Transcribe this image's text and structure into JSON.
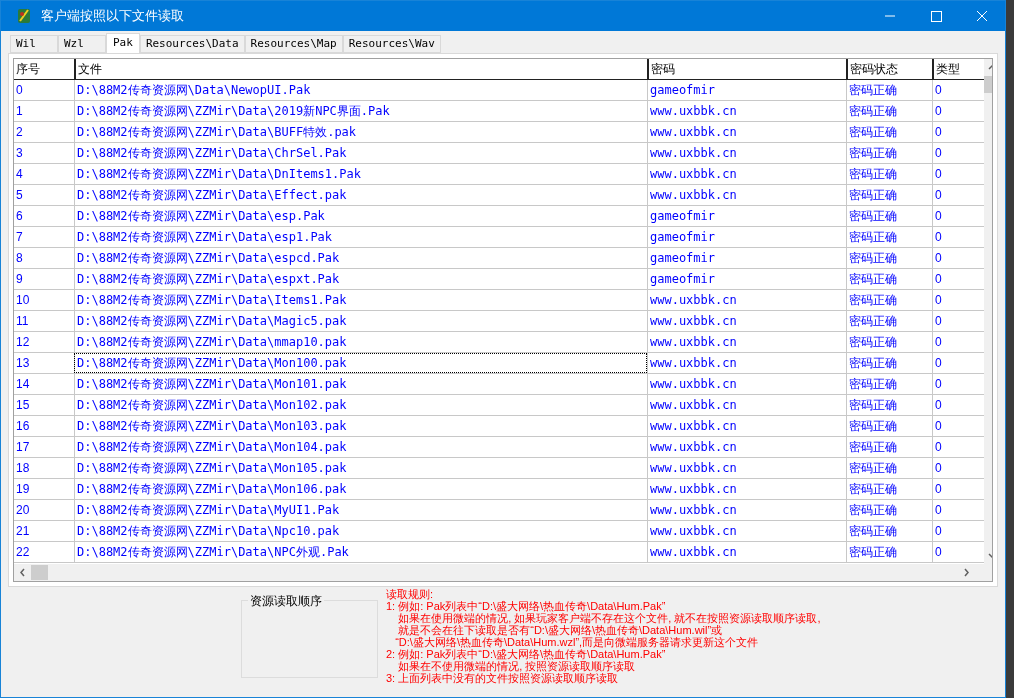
{
  "window": {
    "title": "客户端按照以下文件读取"
  },
  "tabs": [
    {
      "label": "Wil",
      "selected": false
    },
    {
      "label": "Wzl",
      "selected": false
    },
    {
      "label": "Pak",
      "selected": true
    },
    {
      "label": "Resources\\Data",
      "selected": false
    },
    {
      "label": "Resources\\Map",
      "selected": false
    },
    {
      "label": "Resources\\Wav",
      "selected": false
    }
  ],
  "table": {
    "columns": [
      "序号",
      "文件",
      "密码",
      "密码状态",
      "类型"
    ],
    "rows": [
      {
        "cells": [
          "0",
          "D:\\88M2传奇资源网\\Data\\NewopUI.Pak",
          "gameofmir",
          "密码正确",
          "0"
        ],
        "focused": false
      },
      {
        "cells": [
          "1",
          "D:\\88M2传奇资源网\\ZZMir\\Data\\2019新NPC界面.Pak",
          "www.uxbbk.cn",
          "密码正确",
          "0"
        ],
        "focused": false
      },
      {
        "cells": [
          "2",
          "D:\\88M2传奇资源网\\ZZMir\\Data\\BUFF特效.pak",
          "www.uxbbk.cn",
          "密码正确",
          "0"
        ],
        "focused": false
      },
      {
        "cells": [
          "3",
          "D:\\88M2传奇资源网\\ZZMir\\Data\\ChrSel.Pak",
          "www.uxbbk.cn",
          "密码正确",
          "0"
        ],
        "focused": false
      },
      {
        "cells": [
          "4",
          "D:\\88M2传奇资源网\\ZZMir\\Data\\DnItems1.Pak",
          "www.uxbbk.cn",
          "密码正确",
          "0"
        ],
        "focused": false
      },
      {
        "cells": [
          "5",
          "D:\\88M2传奇资源网\\ZZMir\\Data\\Effect.pak",
          "www.uxbbk.cn",
          "密码正确",
          "0"
        ],
        "focused": false
      },
      {
        "cells": [
          "6",
          "D:\\88M2传奇资源网\\ZZMir\\Data\\esp.Pak",
          "gameofmir",
          "密码正确",
          "0"
        ],
        "focused": false
      },
      {
        "cells": [
          "7",
          "D:\\88M2传奇资源网\\ZZMir\\Data\\esp1.Pak",
          "gameofmir",
          "密码正确",
          "0"
        ],
        "focused": false
      },
      {
        "cells": [
          "8",
          "D:\\88M2传奇资源网\\ZZMir\\Data\\espcd.Pak",
          "gameofmir",
          "密码正确",
          "0"
        ],
        "focused": false
      },
      {
        "cells": [
          "9",
          "D:\\88M2传奇资源网\\ZZMir\\Data\\espxt.Pak",
          "gameofmir",
          "密码正确",
          "0"
        ],
        "focused": false
      },
      {
        "cells": [
          "10",
          "D:\\88M2传奇资源网\\ZZMir\\Data\\Items1.Pak",
          "www.uxbbk.cn",
          "密码正确",
          "0"
        ],
        "focused": false
      },
      {
        "cells": [
          "11",
          "D:\\88M2传奇资源网\\ZZMir\\Data\\Magic5.pak",
          "www.uxbbk.cn",
          "密码正确",
          "0"
        ],
        "focused": false
      },
      {
        "cells": [
          "12",
          "D:\\88M2传奇资源网\\ZZMir\\Data\\mmap10.pak",
          "www.uxbbk.cn",
          "密码正确",
          "0"
        ],
        "focused": false
      },
      {
        "cells": [
          "13",
          "D:\\88M2传奇资源网\\ZZMir\\Data\\Mon100.pak",
          "www.uxbbk.cn",
          "密码正确",
          "0"
        ],
        "focused": true
      },
      {
        "cells": [
          "14",
          "D:\\88M2传奇资源网\\ZZMir\\Data\\Mon101.pak",
          "www.uxbbk.cn",
          "密码正确",
          "0"
        ],
        "focused": false
      },
      {
        "cells": [
          "15",
          "D:\\88M2传奇资源网\\ZZMir\\Data\\Mon102.pak",
          "www.uxbbk.cn",
          "密码正确",
          "0"
        ],
        "focused": false
      },
      {
        "cells": [
          "16",
          "D:\\88M2传奇资源网\\ZZMir\\Data\\Mon103.pak",
          "www.uxbbk.cn",
          "密码正确",
          "0"
        ],
        "focused": false
      },
      {
        "cells": [
          "17",
          "D:\\88M2传奇资源网\\ZZMir\\Data\\Mon104.pak",
          "www.uxbbk.cn",
          "密码正确",
          "0"
        ],
        "focused": false
      },
      {
        "cells": [
          "18",
          "D:\\88M2传奇资源网\\ZZMir\\Data\\Mon105.pak",
          "www.uxbbk.cn",
          "密码正确",
          "0"
        ],
        "focused": false
      },
      {
        "cells": [
          "19",
          "D:\\88M2传奇资源网\\ZZMir\\Data\\Mon106.pak",
          "www.uxbbk.cn",
          "密码正确",
          "0"
        ],
        "focused": false
      },
      {
        "cells": [
          "20",
          "D:\\88M2传奇资源网\\ZZMir\\Data\\MyUI1.Pak",
          "www.uxbbk.cn",
          "密码正确",
          "0"
        ],
        "focused": false
      },
      {
        "cells": [
          "21",
          "D:\\88M2传奇资源网\\ZZMir\\Data\\Npc10.pak",
          "www.uxbbk.cn",
          "密码正确",
          "0"
        ],
        "focused": false
      },
      {
        "cells": [
          "22",
          "D:\\88M2传奇资源网\\ZZMir\\Data\\NPC外观.Pak",
          "www.uxbbk.cn",
          "密码正确",
          "0"
        ],
        "focused": false
      }
    ]
  },
  "order_group": {
    "title": "资源读取顺序"
  },
  "rules": [
    "读取规则:",
    "1: 例如: Pak列表中“D:\\盛大网络\\热血传奇\\Data\\Hum.Pak”",
    "    如果在使用微端的情况, 如果玩家客户端不存在这个文件, 就不在按照资源读取顺序读取,",
    "    就是不会在往下读取是否有“D:\\盛大网络\\热血传奇\\Data\\Hum.wil”或",
    "   “D:\\盛大网络\\热血传奇\\Data\\Hum.wzl”,而是向微端服务器请求更新这个文件",
    "2: 例如: Pak列表中“D:\\盛大网络\\热血传奇\\Data\\Hum.Pak”",
    "    如果在不使用微端的情况, 按照资源读取顺序读取",
    "3: 上面列表中没有的文件按照资源读取顺序读取"
  ]
}
